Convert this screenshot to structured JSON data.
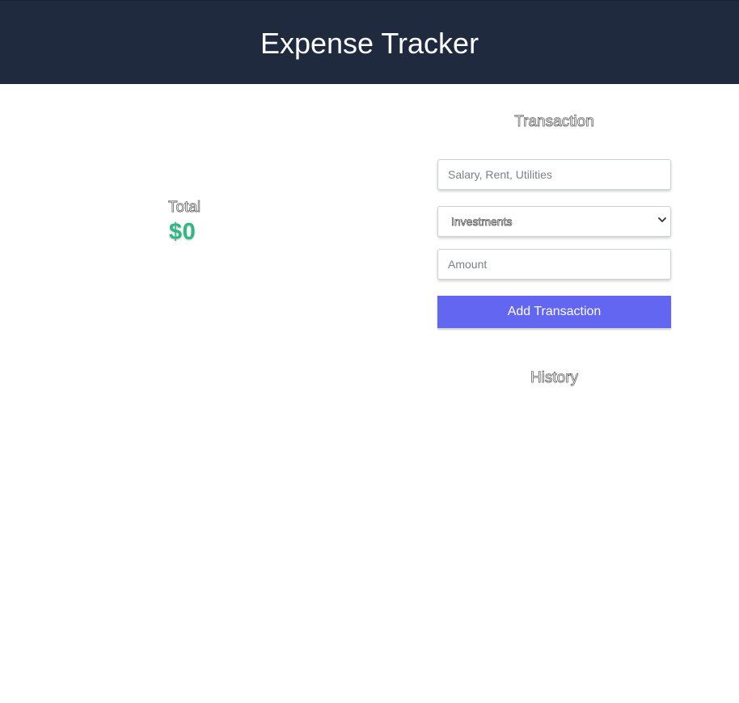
{
  "header": {
    "title": "Expense Tracker"
  },
  "summary": {
    "total_label": "Total",
    "total_value": "$0"
  },
  "transaction_form": {
    "heading": "Transaction",
    "description_placeholder": "Salary, Rent, Utilities",
    "description_value": "",
    "category_selected": "Investments",
    "amount_placeholder": "Amount",
    "amount_value": "",
    "submit_label": "Add Transaction"
  },
  "history": {
    "heading": "History",
    "items": []
  },
  "colors": {
    "header_bg": "#1f2a3e",
    "accent": "#6366f1",
    "total_green": "#2fb886"
  }
}
